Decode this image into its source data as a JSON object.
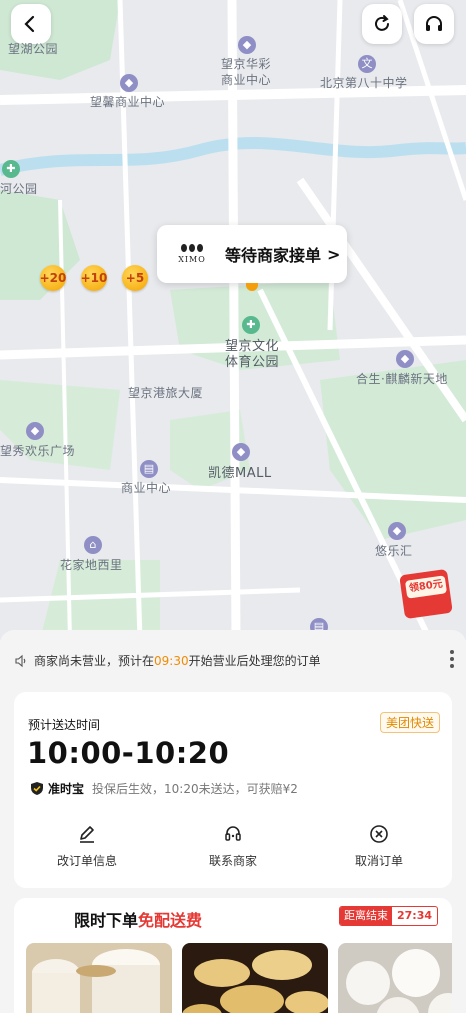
{
  "map": {
    "labels": {
      "park_left": "望湖公园",
      "huacai_1": "望京华彩",
      "huacai_2": "商业中心",
      "school": "北京第八十中学",
      "wangxin": "望馨商业中心",
      "river_park": "河公园",
      "culture_1": "望京文化",
      "culture_2": "体育公园",
      "ganglv": "望京港旅大厦",
      "qilin": "合生·麒麟新天地",
      "xiuxiu": "望秀欢乐广场",
      "kaide": "凯德MALL",
      "shangye": "商业中心",
      "huajia": "花家地西里",
      "youle": "悠乐汇"
    },
    "coins": [
      "+20",
      "+10",
      "+5"
    ],
    "bubble": {
      "brand": "XIMO",
      "text": "等待商家接单",
      "chevron": ">"
    },
    "promo_badge": "领80元"
  },
  "notice": {
    "prefix": "商家尚未营业，预计在",
    "time": "09:30",
    "suffix": "开始营业后处理您的订单"
  },
  "delivery": {
    "label": "预计送达时间",
    "time": "10:00-10:20",
    "tag": "美团快送",
    "guarantee_name": "准时宝",
    "guarantee_desc": "投保后生效，10:20未送达，可获赔¥2"
  },
  "actions": [
    {
      "label": "改订单信息",
      "icon": "edit-icon"
    },
    {
      "label": "联系商家",
      "icon": "merchant-icon"
    },
    {
      "label": "取消订单",
      "icon": "cancel-icon"
    }
  ],
  "promo": {
    "title_prefix": "限时下单",
    "title_highlight": "免配送费",
    "countdown_label": "距离结束",
    "countdown_value": "27:34"
  },
  "colors": {
    "accent_orange": "#f08c00",
    "accent_red": "#e53935"
  }
}
